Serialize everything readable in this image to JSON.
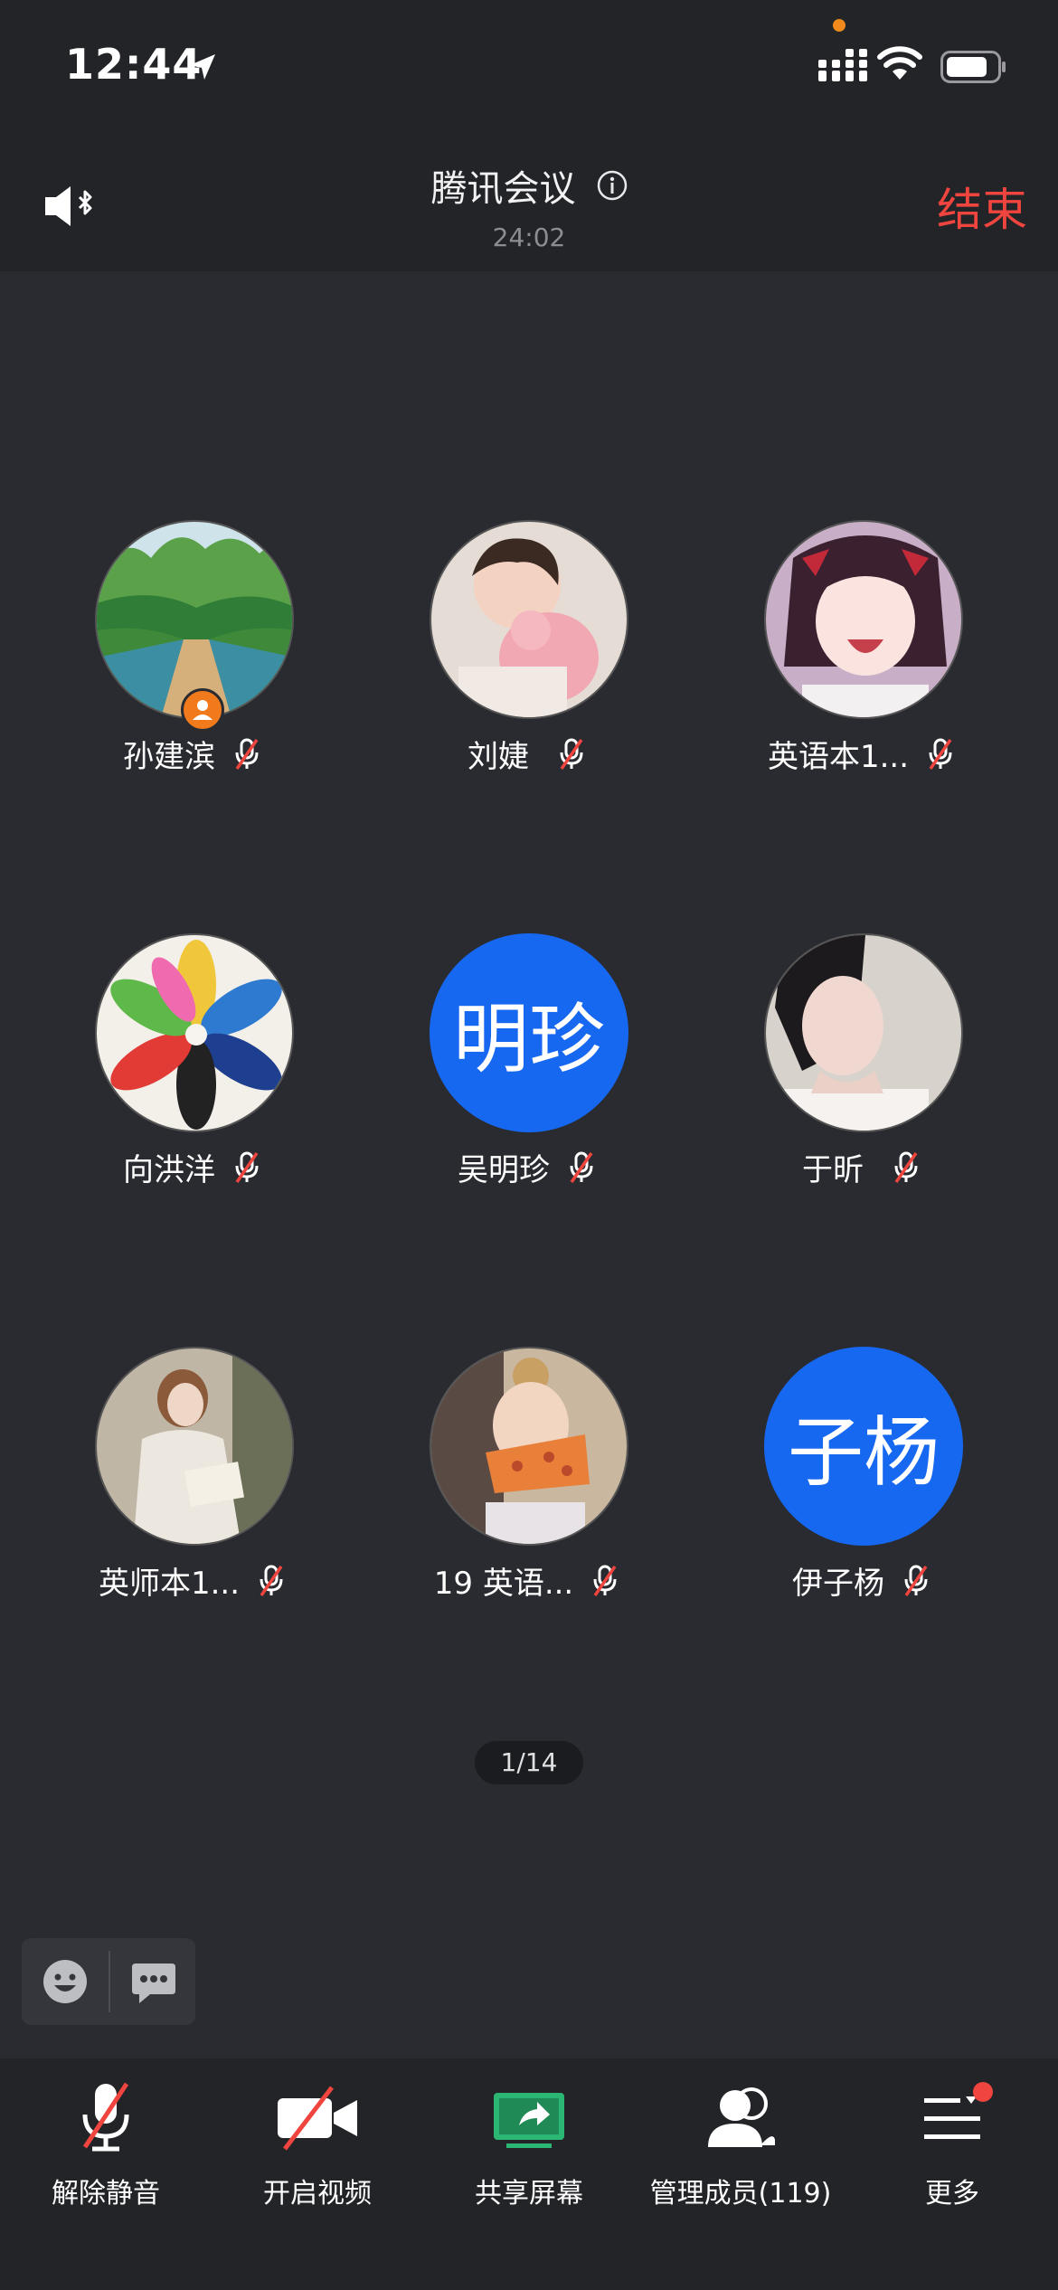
{
  "status_bar": {
    "time": "12:44"
  },
  "header": {
    "title": "腾讯会议",
    "duration": "24:02",
    "end_label": "结束"
  },
  "participants": [
    {
      "name": "孙建滨",
      "avatar": "photo-landscape",
      "host": true
    },
    {
      "name": "刘婕",
      "avatar": "photo-baby"
    },
    {
      "name": "英语本1...",
      "avatar": "photo-anime"
    },
    {
      "name": "向洪洋",
      "avatar": "photo-pinwheel"
    },
    {
      "name": "吴明珍",
      "avatar_text": "明珍"
    },
    {
      "name": "于昕",
      "avatar": "photo-woman"
    },
    {
      "name": "英师本1...",
      "avatar": "photo-reading"
    },
    {
      "name": "19 英语...",
      "avatar": "photo-child-pizza"
    },
    {
      "name": "伊子杨",
      "avatar_text": "子杨"
    }
  ],
  "pager": "1/14",
  "toolbar": {
    "unmute": "解除静音",
    "video": "开启视频",
    "share": "共享屏幕",
    "members": "管理成员(119)",
    "more": "更多"
  },
  "colors": {
    "accent": "#1768f0",
    "end": "#f0453e",
    "share": "#2bb673"
  }
}
